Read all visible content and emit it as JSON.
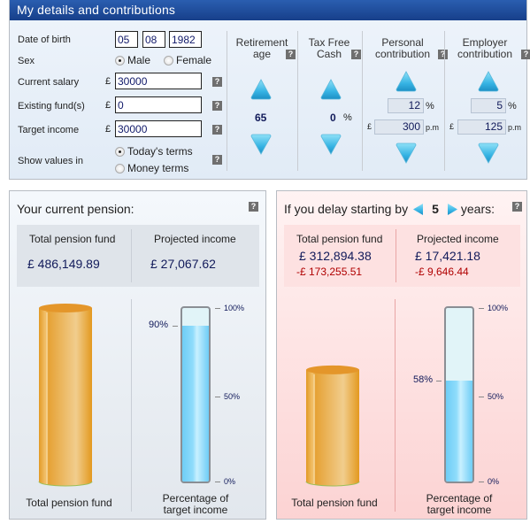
{
  "details": {
    "header": "My details and contributions",
    "dob": {
      "label": "Date of birth",
      "day": "05",
      "month": "08",
      "year": "1982"
    },
    "sex": {
      "label": "Sex",
      "options": [
        "Male",
        "Female"
      ],
      "selected": "Male"
    },
    "salary": {
      "label": "Current salary",
      "currency": "£",
      "value": "30000"
    },
    "existing": {
      "label": "Existing fund(s)",
      "currency": "£",
      "value": "0"
    },
    "target": {
      "label": "Target income",
      "currency": "£",
      "value": "30000"
    },
    "show_values": {
      "label": "Show values in",
      "options": [
        "Today's terms",
        "Money terms"
      ],
      "selected": "Today's terms"
    },
    "help_glyph": "?",
    "retirement": {
      "title_line1": "Retirement",
      "title_line2": "age",
      "value": "65"
    },
    "taxfree": {
      "title_line1": "Tax Free",
      "title_line2": "Cash",
      "value": "0",
      "unit": "%"
    },
    "personal": {
      "title_line1": "Personal",
      "title_line2": "contribution",
      "percent": "12",
      "percent_unit": "%",
      "currency": "£",
      "amount": "300",
      "amount_unit": "p.m"
    },
    "employer": {
      "title_line1": "Employer",
      "title_line2": "contribution",
      "percent": "5",
      "percent_unit": "%",
      "currency": "£",
      "amount": "125",
      "amount_unit": "p.m"
    }
  },
  "current": {
    "title": "Your current pension:",
    "fund_label": "Total pension fund",
    "fund_value": "£ 486,149.89",
    "income_label": "Projected income",
    "income_value": "£ 27,067.62",
    "cyl_caption": "Total pension fund",
    "thermo_caption_line1": "Percentage of",
    "thermo_caption_line2": "target income",
    "percent_label": "90%",
    "percent": 90,
    "fund_relative": 1.0
  },
  "delay": {
    "title_prefix": "If you delay starting by",
    "years": "5",
    "title_suffix": "years:",
    "fund_label": "Total pension fund",
    "fund_value": "£ 312,894.38",
    "fund_diff": "-£ 173,255.51",
    "income_label": "Projected income",
    "income_value": "£ 17,421.18",
    "income_diff": "-£ 9,646.44",
    "cyl_caption": "Total pension fund",
    "thermo_caption_line1": "Percentage of",
    "thermo_caption_line2": "target income",
    "percent_label": "58%",
    "percent": 58,
    "fund_relative": 0.6436
  },
  "scale": {
    "top": "100%",
    "mid": "50%",
    "bottom": "0%"
  },
  "colors": {
    "header": "#1f4c9c",
    "value_text": "#111a5a",
    "negative": "#b00000",
    "cylinder": "#e8a331",
    "thermo_fill": "#6ecdf6"
  }
}
